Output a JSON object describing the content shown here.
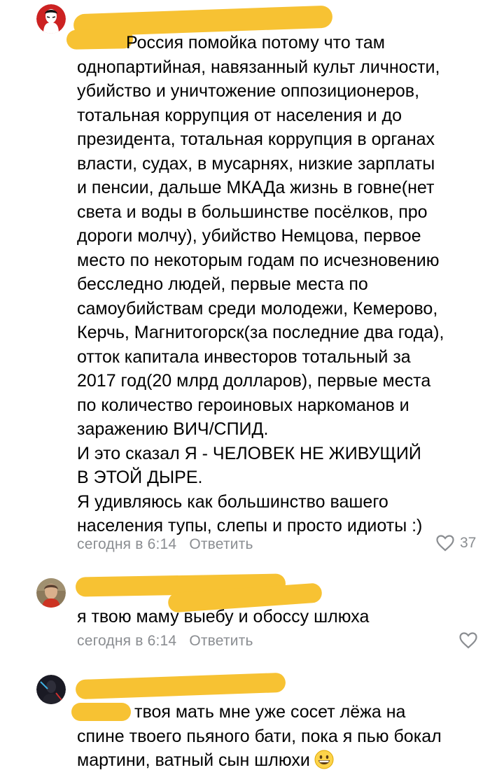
{
  "comments": [
    {
      "text": "Россия помойка потому что там\nоднопартийная, навязанный культ личности,\nубийство и уничтожение оппозиционеров,\nтотальная коррупция от населения и до\nпрезидента, тотальная коррупция в органах\nвласти, судах, в мусарнях, низкие зарплаты\nи пенсии, дальше МКАДа жизнь в говне(нет\nсвета и воды в большинстве посёлков, про\nдороги молчу), убийство Немцова, первое\nместо по некоторым годам по исчезновению\nбесследно людей, первые места по\nсамоубийствам среди молодежи, Кемерово,\nКерчь, Магнитогорск(за последние два года),\nотток капитала инвесторов тотальный за\n2017 год(20 млрд долларов), первые места\nпо количество героиновых наркоманов и\nзаражению ВИЧ/СПИД.\nИ это сказал Я - ЧЕЛОВЕК НЕ ЖИВУЩИЙ\nВ ЭТОЙ ДЫРЕ.\nЯ удивляюсь как большинство вашего\nнаселения тупы, слепы и просто идиоты :)",
      "time": "сегодня в 6:14",
      "reply_label": "Ответить",
      "likes": "37",
      "avatar_icon": "masked-face-avatar-icon"
    },
    {
      "text": "я твою маму выебу и обоссу шлюха",
      "time": "сегодня в 6:14",
      "reply_label": "Ответить",
      "likes": "",
      "avatar_icon": "photo-avatar-icon"
    },
    {
      "text": "твоя мать мне уже сосет лёжа на\nспине твоего пьяного бати, пока я пью бокал\nмартини, ватный сын шлюхи",
      "emoji": "grinning-face-emoji",
      "avatar_icon": "dark-figure-avatar-icon"
    }
  ],
  "colors": {
    "redaction": "#f7c233",
    "meta_text": "#8a8d91",
    "body_text": "#000000"
  }
}
